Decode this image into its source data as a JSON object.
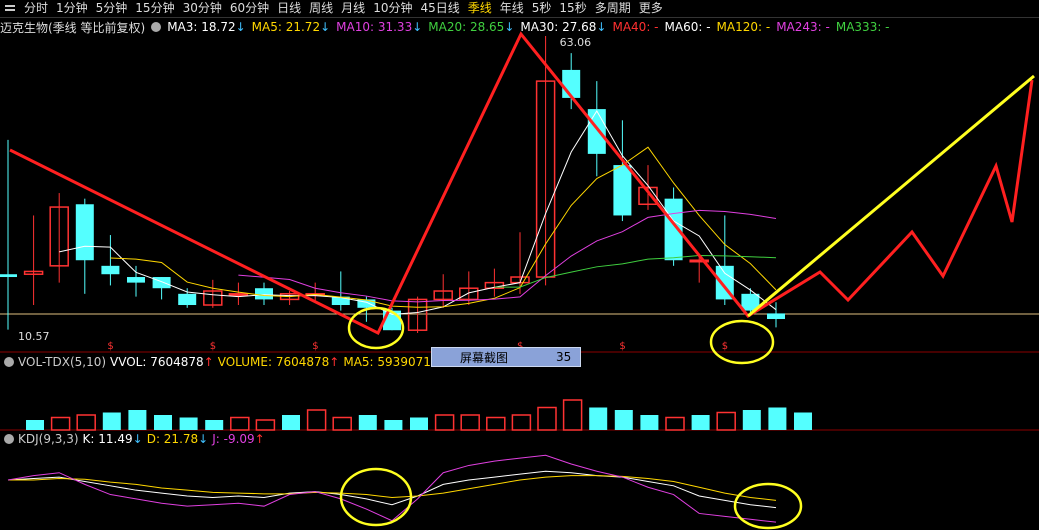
{
  "toolbar": {
    "tabs": [
      "分时",
      "1分钟",
      "5分钟",
      "15分钟",
      "30分钟",
      "60分钟",
      "日线",
      "周线",
      "月线",
      "10分钟",
      "45日线",
      "季线",
      "年线",
      "5秒",
      "15秒",
      "多周期",
      "更多"
    ],
    "active": "季线"
  },
  "main": {
    "stock": "迈克生物(季线 等比前复权)",
    "ma": [
      {
        "label": "MA3: 18.72",
        "arrow": "↓",
        "color": "#ffffff"
      },
      {
        "label": "MA5: 21.72",
        "arrow": "↓",
        "color": "#ffd700"
      },
      {
        "label": "MA10: 31.33",
        "arrow": "↓",
        "color": "#e040e0"
      },
      {
        "label": "MA20: 28.65",
        "arrow": "↓",
        "color": "#40d040"
      },
      {
        "label": "MA30: 27.68",
        "arrow": "↓",
        "color": "#ffffff"
      },
      {
        "label": "MA40: -",
        "arrow": "",
        "color": "#ff3030"
      },
      {
        "label": "MA60: -",
        "arrow": "",
        "color": "#ffffff"
      },
      {
        "label": "MA120: -",
        "arrow": "",
        "color": "#ffd700"
      },
      {
        "label": "MA243: -",
        "arrow": "",
        "color": "#e040e0"
      },
      {
        "label": "MA333: -",
        "arrow": "",
        "color": "#40d040"
      }
    ],
    "high_label": "63.06",
    "low_label": "10.57"
  },
  "volume_bar": {
    "items": [
      {
        "label": "VOL-TDX(5,10)",
        "color": "#cccccc"
      },
      {
        "label": "VVOL: 7604878",
        "arrow": "↑",
        "color": "#ffffff"
      },
      {
        "label": "VOLUME: 7604878",
        "arrow": "↑",
        "color": "#ffd700"
      },
      {
        "label": "MA5: 5939071",
        "arrow": "↑",
        "color": "#ffd700"
      },
      {
        "label": "MA10:",
        "arrow": "",
        "color": "#e040e0"
      }
    ]
  },
  "kdj_bar": {
    "items": [
      {
        "label": "KDJ(9,3,3)",
        "color": "#cccccc"
      },
      {
        "label": "K: 11.49",
        "arrow": "↓",
        "color": "#ffffff"
      },
      {
        "label": "D: 21.78",
        "arrow": "↓",
        "color": "#ffd700"
      },
      {
        "label": "J: -9.09",
        "arrow": "↑",
        "color": "#e040e0"
      }
    ]
  },
  "toast": {
    "label": "屏幕截图",
    "count": "35"
  },
  "chart_data": {
    "type": "candlestick",
    "candles": [
      {
        "o": 20.5,
        "c": 20.0,
        "h": 44.5,
        "l": 10.6
      },
      {
        "o": 20.5,
        "c": 21.0,
        "h": 31.0,
        "l": 15.0
      },
      {
        "o": 22.0,
        "c": 32.5,
        "h": 35.0,
        "l": 19.0
      },
      {
        "o": 33.0,
        "c": 23.0,
        "h": 34.0,
        "l": 17.0
      },
      {
        "o": 22.0,
        "c": 20.5,
        "h": 27.5,
        "l": 18.5
      },
      {
        "o": 20.0,
        "c": 19.0,
        "h": 22.0,
        "l": 16.5
      },
      {
        "o": 20.0,
        "c": 18.0,
        "h": 20.0,
        "l": 16.0
      },
      {
        "o": 17.0,
        "c": 15.0,
        "h": 18.0,
        "l": 14.5
      },
      {
        "o": 15.0,
        "c": 17.5,
        "h": 19.5,
        "l": 14.5
      },
      {
        "o": 17.0,
        "c": 17.0,
        "h": 19.0,
        "l": 15.0
      },
      {
        "o": 18.0,
        "c": 16.0,
        "h": 19.0,
        "l": 15.0
      },
      {
        "o": 16.0,
        "c": 17.0,
        "h": 17.5,
        "l": 15.0
      },
      {
        "o": 17.0,
        "c": 17.0,
        "h": 19.0,
        "l": 15.5
      },
      {
        "o": 16.5,
        "c": 15.0,
        "h": 21.0,
        "l": 14.0
      },
      {
        "o": 16.0,
        "c": 14.5,
        "h": 16.5,
        "l": 12.0
      },
      {
        "o": 14.0,
        "c": 10.5,
        "h": 14.5,
        "l": 10.5
      },
      {
        "o": 10.5,
        "c": 16.0,
        "h": 16.5,
        "l": 10.0
      },
      {
        "o": 16.0,
        "c": 17.5,
        "h": 20.5,
        "l": 14.5
      },
      {
        "o": 16.0,
        "c": 18.0,
        "h": 21.0,
        "l": 15.0
      },
      {
        "o": 18.0,
        "c": 19.0,
        "h": 21.5,
        "l": 16.5
      },
      {
        "o": 19.0,
        "c": 20.0,
        "h": 28.0,
        "l": 17.0
      },
      {
        "o": 20.0,
        "c": 55.0,
        "h": 63.06,
        "l": 18.5
      },
      {
        "o": 57.0,
        "c": 52.0,
        "h": 60.0,
        "l": 50.0
      },
      {
        "o": 50.0,
        "c": 42.0,
        "h": 55.0,
        "l": 38.0
      },
      {
        "o": 40.0,
        "c": 31.0,
        "h": 48.0,
        "l": 30.0
      },
      {
        "o": 33.0,
        "c": 36.0,
        "h": 40.0,
        "l": 32.0
      },
      {
        "o": 34.0,
        "c": 23.0,
        "h": 36.0,
        "l": 22.0
      },
      {
        "o": 23.0,
        "c": 23.0,
        "h": 24.0,
        "l": 19.0
      },
      {
        "o": 22.0,
        "c": 16.0,
        "h": 31.0,
        "l": 15.0
      },
      {
        "o": 17.0,
        "c": 14.0,
        "h": 18.0,
        "l": 13.0
      },
      {
        "o": 13.5,
        "c": 12.5,
        "h": 15.5,
        "l": 11.0
      }
    ],
    "kdj": {
      "k": [
        66,
        68,
        70,
        64,
        58,
        52,
        48,
        44,
        42,
        44,
        42,
        48,
        50,
        46,
        40,
        32,
        44,
        60,
        66,
        70,
        74,
        78,
        76,
        72,
        70,
        64,
        58,
        44,
        38,
        32,
        28
      ],
      "d": [
        66,
        66,
        68,
        67,
        63,
        60,
        55,
        52,
        49,
        48,
        47,
        47,
        49,
        48,
        46,
        42,
        44,
        48,
        54,
        60,
        66,
        70,
        72,
        72,
        71,
        68,
        64,
        56,
        48,
        42,
        38
      ],
      "j": [
        66,
        72,
        76,
        60,
        46,
        40,
        34,
        30,
        32,
        34,
        30,
        46,
        50,
        40,
        26,
        10,
        40,
        76,
        86,
        92,
        96,
        100,
        88,
        78,
        70,
        56,
        46,
        20,
        16,
        12,
        8
      ]
    }
  }
}
